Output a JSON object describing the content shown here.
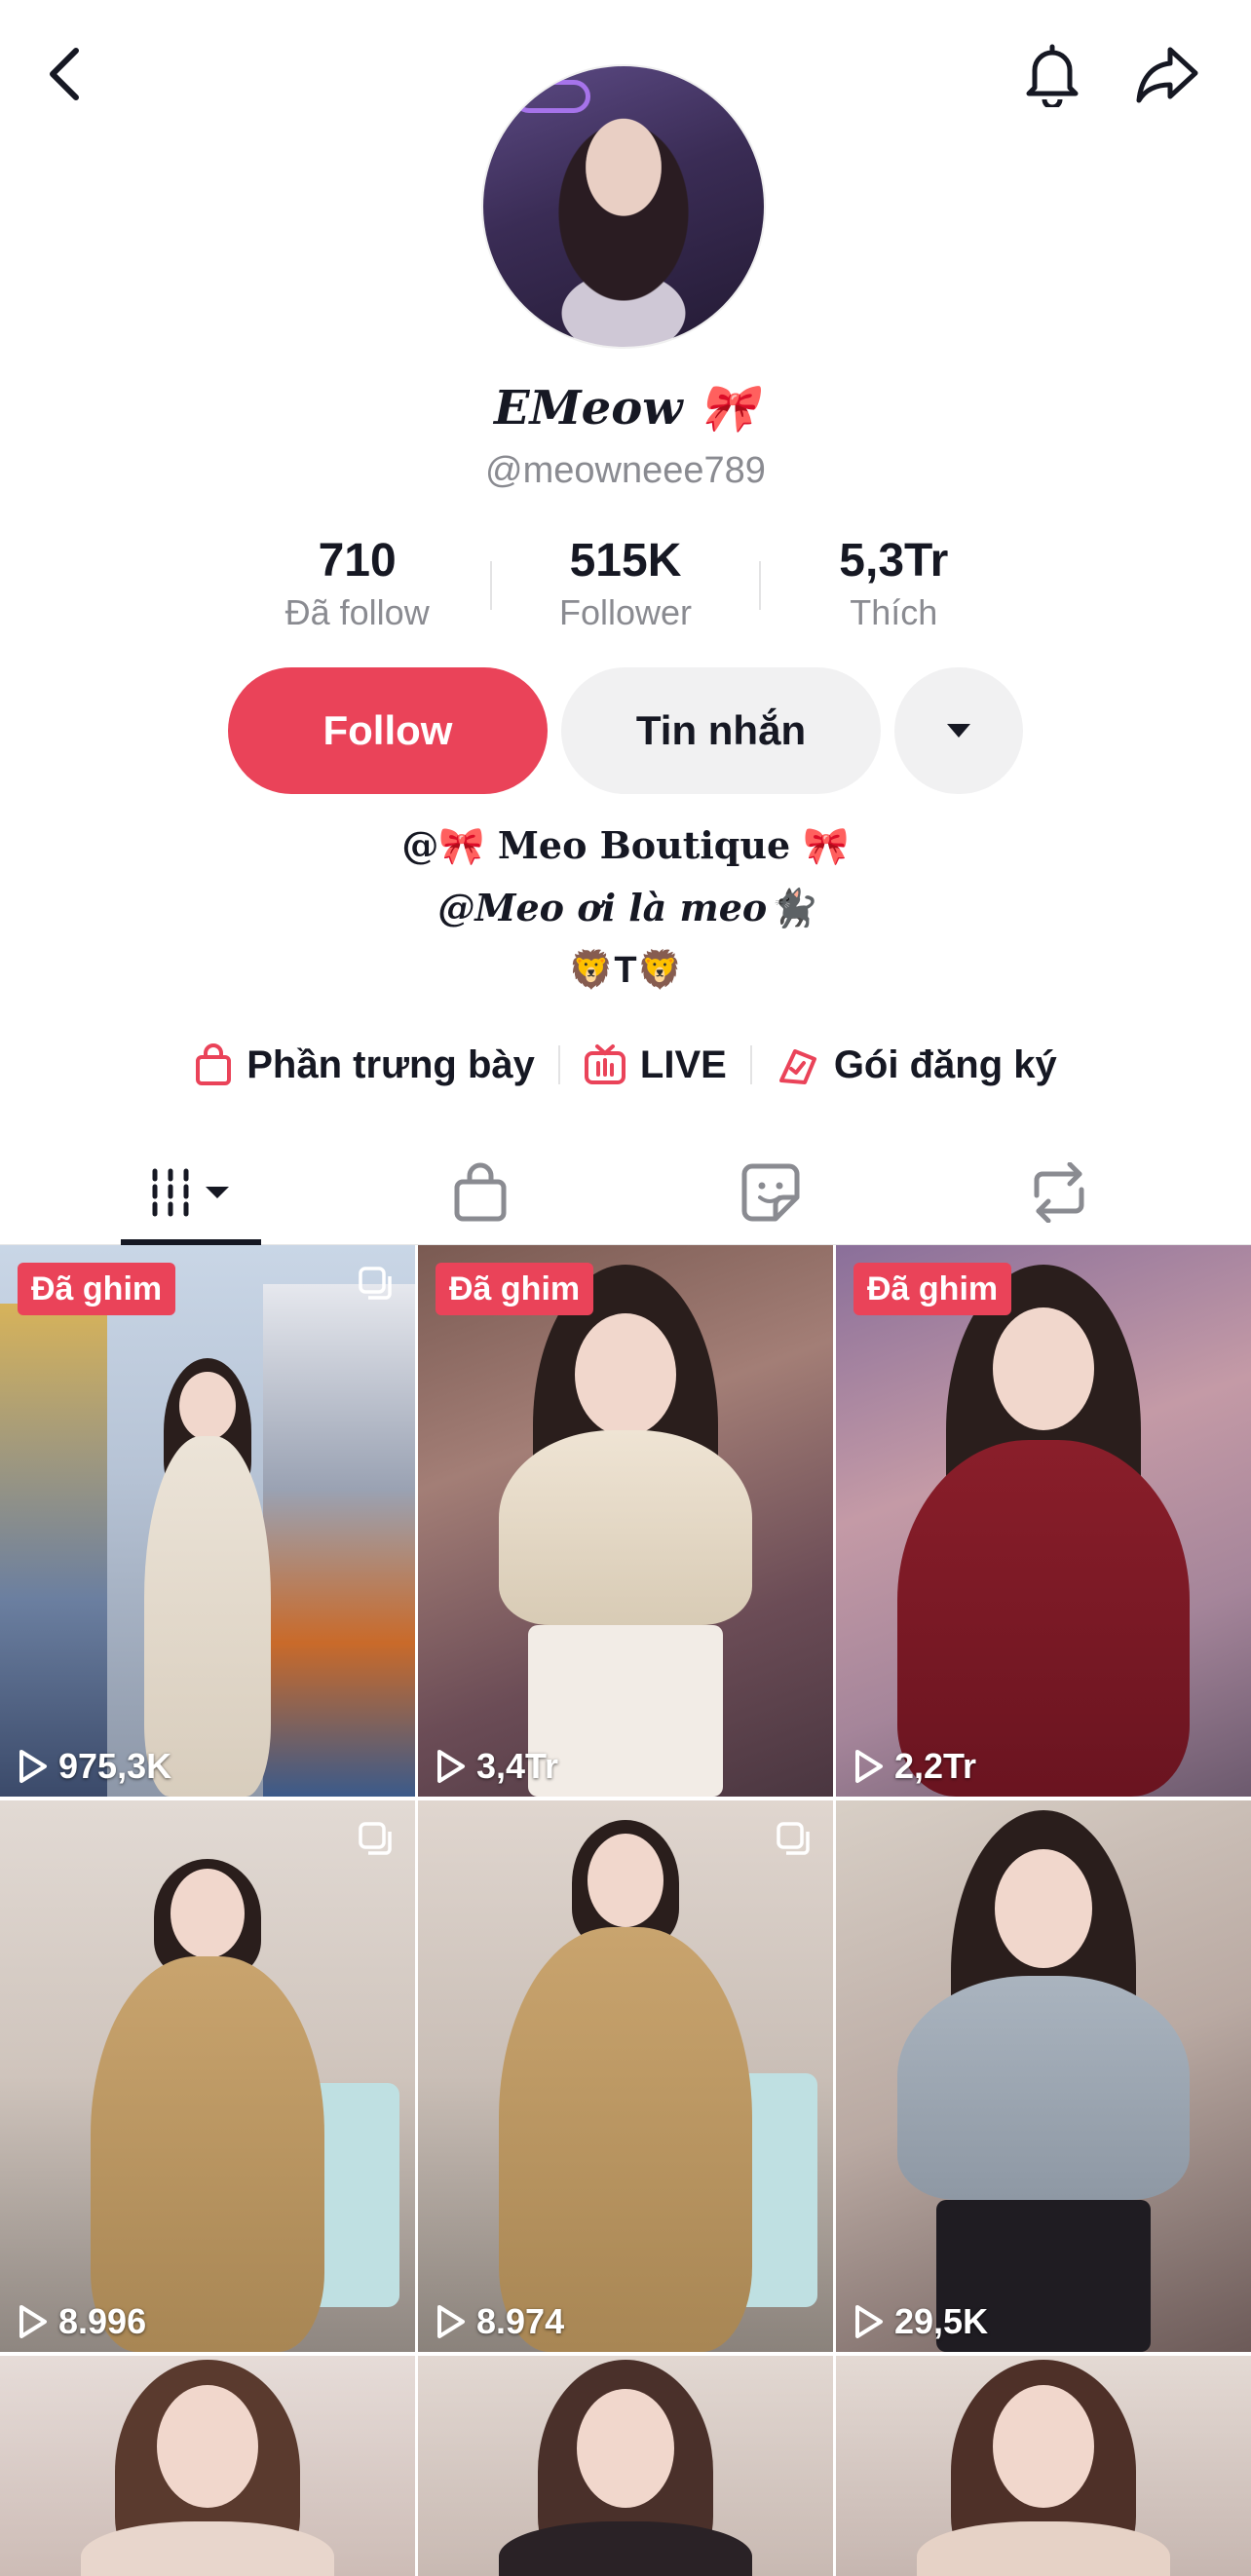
{
  "profile": {
    "display_name": "EMeow 🎀",
    "username": "@meowneee789"
  },
  "stats": [
    {
      "value": "710",
      "label": "Đã follow"
    },
    {
      "value": "515K",
      "label": "Follower"
    },
    {
      "value": "5,3Tr",
      "label": "Thích"
    }
  ],
  "actions": {
    "follow_label": "Follow",
    "message_label": "Tin nhắn"
  },
  "bio": {
    "line1": "@🎀 Meo Boutique 🎀",
    "line2": "@Meo ơi là meo🐈‍⬛",
    "line3": "🦁T🦁"
  },
  "links": [
    {
      "label": "Phần trưng bày",
      "icon": "shopping-bag-icon"
    },
    {
      "label": "LIVE",
      "icon": "live-tv-icon"
    },
    {
      "label": "Gói đăng ký",
      "icon": "subscription-icon"
    }
  ],
  "tabs": [
    {
      "name": "videos",
      "icon": "grid-icon",
      "active": true
    },
    {
      "name": "shop",
      "icon": "shopping-bag-icon"
    },
    {
      "name": "favorites",
      "icon": "sticker-icon"
    },
    {
      "name": "reposts",
      "icon": "repost-icon"
    }
  ],
  "videos": [
    {
      "views": "975,3K",
      "pinned": "Đã ghim",
      "multi": true
    },
    {
      "views": "3,4Tr",
      "pinned": "Đã ghim",
      "multi": false
    },
    {
      "views": "2,2Tr",
      "pinned": "Đã ghim",
      "multi": false
    },
    {
      "views": "8.996",
      "pinned": "",
      "multi": true
    },
    {
      "views": "8.974",
      "pinned": "",
      "multi": true
    },
    {
      "views": "29,5K",
      "pinned": "",
      "multi": false
    },
    {
      "views": "",
      "pinned": "",
      "multi": false
    },
    {
      "views": "",
      "pinned": "",
      "multi": false
    },
    {
      "views": "",
      "pinned": "",
      "multi": false
    }
  ],
  "colors": {
    "accent": "#ea4359",
    "secondary_button": "#f1f1f2",
    "muted_text": "#8a8b91"
  }
}
